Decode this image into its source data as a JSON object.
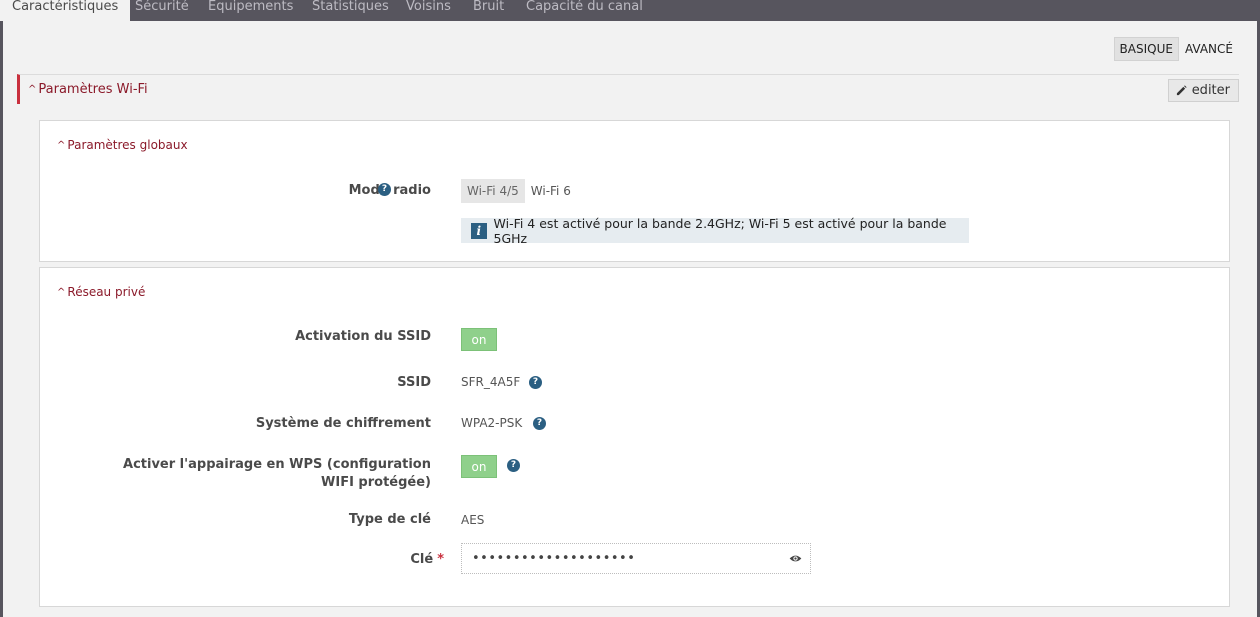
{
  "tabs": [
    {
      "label": "Caractéristiques",
      "active": true
    },
    {
      "label": "Sécurité"
    },
    {
      "label": "Equipements"
    },
    {
      "label": "Statistiques"
    },
    {
      "label": "Voisins"
    },
    {
      "label": "Bruit"
    },
    {
      "label": "Capacité du canal"
    }
  ],
  "mode_toggle": {
    "basic": "BASIQUE",
    "advanced": "AVANCÉ",
    "selected": "BASIQUE"
  },
  "section": {
    "caret": "^",
    "title": "Paramètres Wi-Fi",
    "edit_label": "editer",
    "edit_icon": "pencil-icon",
    "accent_color": "#c9303e"
  },
  "global_panel": {
    "title": "Paramètres globaux",
    "mode_radio": {
      "label": "Mode radio",
      "options": [
        "Wi-Fi 4/5",
        "Wi-Fi 6"
      ],
      "selected": "Wi-Fi 4/5",
      "info_icon": "i",
      "info_text": "Wi-Fi 4 est activé pour la bande 2.4GHz; Wi-Fi 5 est activé pour la bande 5GHz"
    }
  },
  "private_panel": {
    "title": "Réseau privé",
    "ssid_activation": {
      "label": "Activation du SSID",
      "toggle": "on"
    },
    "ssid": {
      "label": "SSID",
      "value": "SFR_4A5F"
    },
    "encryption": {
      "label": "Système de chiffrement",
      "value": "WPA2-PSK"
    },
    "wps": {
      "label": "Activer l'appairage en WPS (configuration WIFI protégée)",
      "toggle": "on"
    },
    "key_type": {
      "label": "Type de clé",
      "value": "AES"
    },
    "key": {
      "label": "Clé",
      "required_mark": "*",
      "value": "••••••••••••••••••••"
    }
  },
  "help_glyph": "?"
}
